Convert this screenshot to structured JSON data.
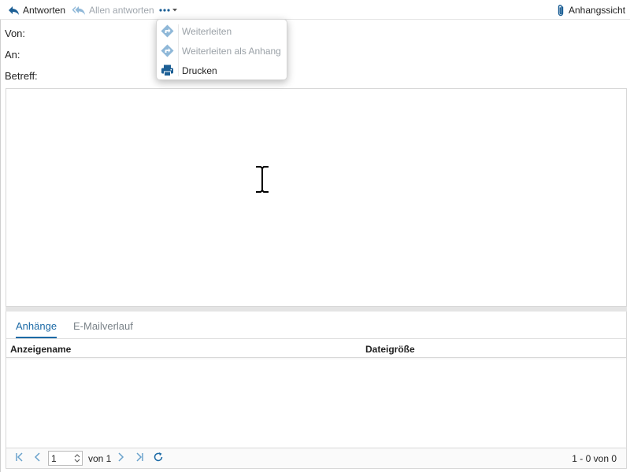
{
  "toolbar": {
    "reply_label": "Antworten",
    "reply_all_label": "Allen antworten",
    "attachment_view_label": "Anhangssicht"
  },
  "more_menu": {
    "items": [
      {
        "label": "Weiterleiten",
        "icon": "forward-icon",
        "enabled": false
      },
      {
        "label": "Weiterleiten als Anhang",
        "icon": "forward-icon",
        "enabled": false
      },
      {
        "label": "Drucken",
        "icon": "printer-icon",
        "enabled": true
      }
    ]
  },
  "header": {
    "from_label": "Von:",
    "to_label": "An:",
    "subject_label": "Betreff:"
  },
  "tabs": [
    {
      "label": "Anhänge",
      "active": true
    },
    {
      "label": "E-Mailverlauf",
      "active": false
    }
  ],
  "grid": {
    "columns": [
      "Anzeigename",
      "Dateigröße"
    ]
  },
  "pager": {
    "page": "1",
    "of_label": "von 1",
    "count_label": "1 - 0 von 0"
  },
  "colors": {
    "accent": "#1c6aa6",
    "disabled_text": "#9aa1a7",
    "icon_disabled": "#8fb8d8"
  }
}
